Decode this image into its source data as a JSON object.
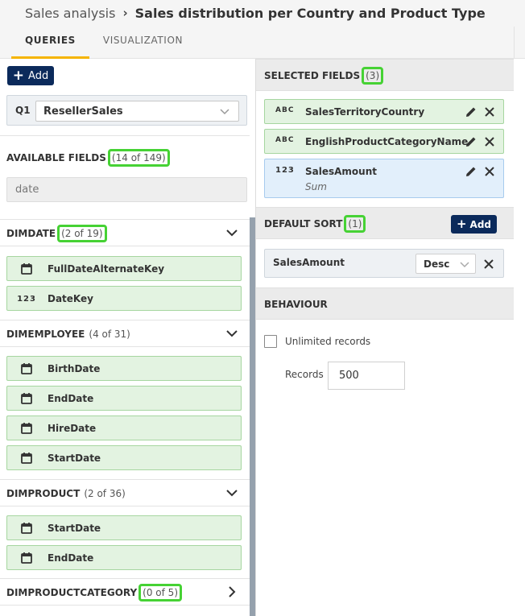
{
  "header": {
    "breadcrumb_root": "Sales analysis",
    "breadcrumb_sep": "›",
    "title": "Sales distribution per Country and Product Type",
    "tabs": [
      {
        "label": "QUERIES",
        "active": true
      },
      {
        "label": "VISUALIZATION",
        "active": false
      }
    ]
  },
  "left": {
    "add_label": "Add",
    "query": {
      "label": "Q1",
      "value": "ResellerSales"
    },
    "available_fields": {
      "title": "AVAILABLE FIELDS",
      "count": "(14 of 149)"
    },
    "search": {
      "value": "date"
    },
    "groups": [
      {
        "title": "DIMDATE",
        "count": "(2 of 19)",
        "expanded": true,
        "fields": [
          {
            "name": "FullDateAlternateKey",
            "type": "date"
          },
          {
            "name": "DateKey",
            "type": "number"
          }
        ]
      },
      {
        "title": "DIMEMPLOYEE",
        "count": "(4 of 31)",
        "expanded": true,
        "fields": [
          {
            "name": "BirthDate",
            "type": "date"
          },
          {
            "name": "EndDate",
            "type": "date"
          },
          {
            "name": "HireDate",
            "type": "date"
          },
          {
            "name": "StartDate",
            "type": "date"
          }
        ]
      },
      {
        "title": "DIMPRODUCT",
        "count": "(2 of 36)",
        "expanded": true,
        "fields": [
          {
            "name": "StartDate",
            "type": "date"
          },
          {
            "name": "EndDate",
            "type": "date"
          }
        ]
      },
      {
        "title": "DIMPRODUCTCATEGORY",
        "count": "(0 of 5)",
        "expanded": false,
        "fields": []
      }
    ]
  },
  "right": {
    "selected_fields": {
      "title": "SELECTED FIELDS",
      "count": "(3)",
      "items": [
        {
          "type_icon": "ABC",
          "name": "SalesTerritoryCountry",
          "sub": ""
        },
        {
          "type_icon": "ABC",
          "name": "EnglishProductCategoryName",
          "sub": ""
        },
        {
          "type_icon": "123",
          "name": "SalesAmount",
          "sub": "Sum"
        }
      ]
    },
    "default_sort": {
      "title": "DEFAULT SORT",
      "count": "(1)",
      "add_label": "Add",
      "field": "SalesAmount",
      "direction": "Desc"
    },
    "behaviour": {
      "title": "BEHAVIOUR",
      "unlimited_label": "Unlimited records",
      "unlimited_checked": false,
      "records_label": "Records",
      "records_value": "500"
    }
  },
  "colors": {
    "accent_navy": "#0b2a5b",
    "highlight_green": "#46d234",
    "field_green": "#e3f3e1",
    "field_blue": "#e2effb",
    "tab_underline": "#f5b400"
  }
}
